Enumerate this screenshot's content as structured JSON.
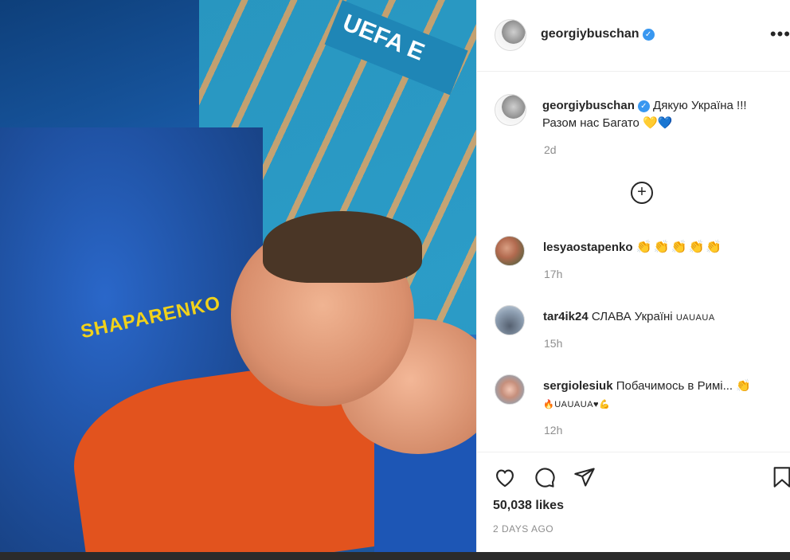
{
  "post": {
    "username": "georgiybuschan",
    "verified_mark": "✓",
    "more_label": "•••"
  },
  "photo": {
    "banner_text": "UEFA E",
    "jersey_text": "SHAPARENKO"
  },
  "caption": {
    "username": "georgiybuschan",
    "text": "Дякую Україна !!! Разом нас Багато",
    "hearts": "💛💙",
    "time": "2d"
  },
  "load_more": {
    "label": "+"
  },
  "comments": [
    {
      "username": "lesyaostapenko",
      "text": "👏👏👏👏👏",
      "time": "17h"
    },
    {
      "username": "tar4ik24",
      "text": "СЛАВА Україні",
      "suffix": "UAUAUA",
      "time": "15h"
    },
    {
      "username": "sergiolesiuk",
      "text": "Побачимось в Римі... 👏",
      "line2": "🔥UAUAUA♥💪",
      "time": "12h"
    }
  ],
  "actions": {
    "likes": "50,038 likes",
    "date": "2 DAYS AGO"
  },
  "colors": {
    "verified": "#3897f0",
    "text": "#262626",
    "muted": "#8e8e8e"
  }
}
